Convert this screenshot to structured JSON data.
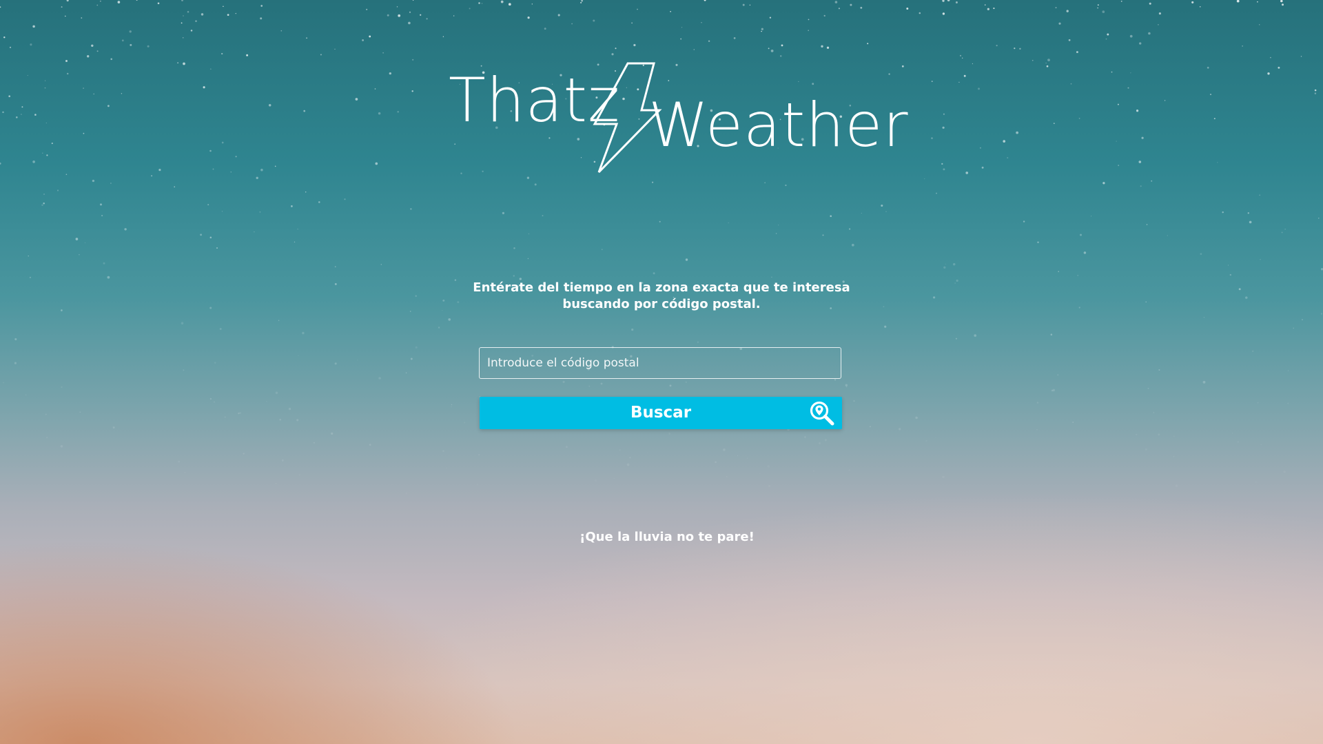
{
  "brand": {
    "name_part1": "Thatz",
    "name_part2": "Weather",
    "logo_icon": "lightning-bolt-icon"
  },
  "intro": {
    "line1": "Entérate del tiempo en la zona exacta que te interesa",
    "line2": "buscando por código postal."
  },
  "search": {
    "placeholder": "Introduce el código postal",
    "value": "",
    "button_label": "Buscar",
    "button_icon": "location-search-icon"
  },
  "footer": {
    "slogan": "¡Que la lluvia no te pare!"
  },
  "colors": {
    "accent": "#00bde3",
    "text": "#ffffff",
    "sky_top": "#26717b",
    "sky_bottom": "#dbbba9"
  }
}
